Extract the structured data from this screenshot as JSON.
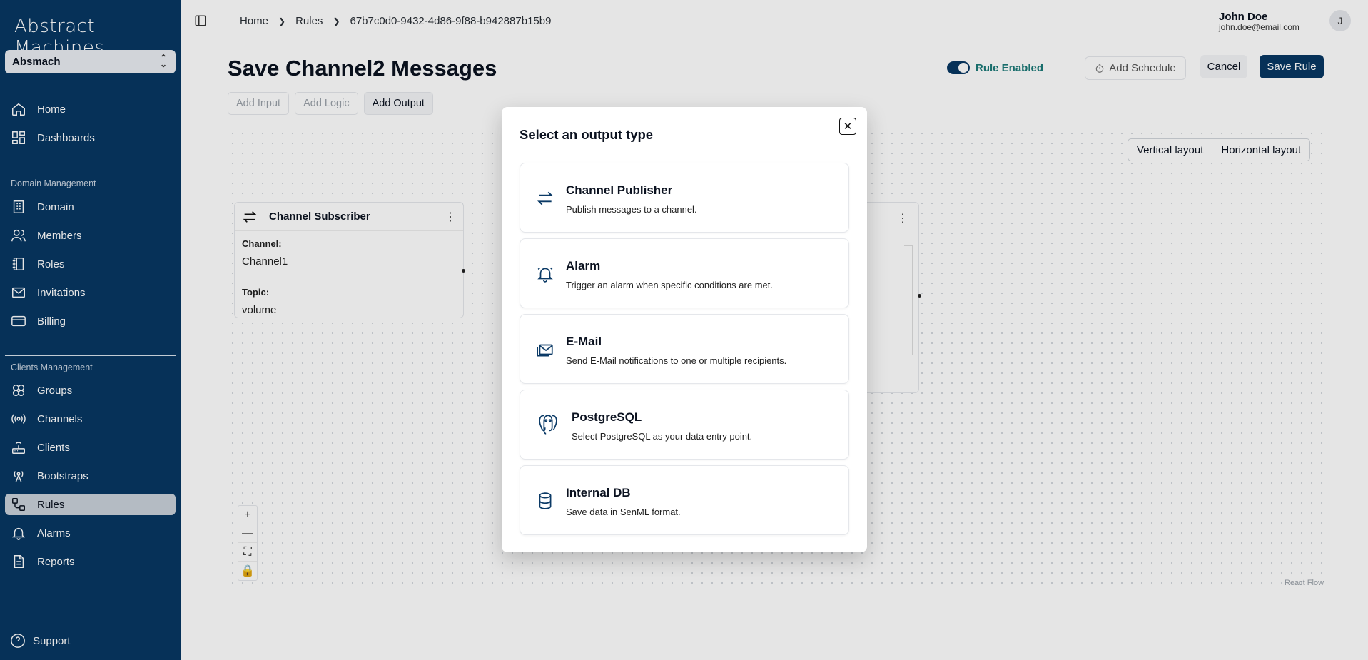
{
  "sidebar": {
    "brand": "Abstract Machines",
    "org": "Absmach",
    "nav_main": [
      {
        "label": "Home",
        "icon": "home-icon"
      },
      {
        "label": "Dashboards",
        "icon": "dashboard-icon"
      }
    ],
    "domain_section": "Domain Management",
    "nav_domain": [
      {
        "label": "Domain",
        "icon": "building-icon"
      },
      {
        "label": "Members",
        "icon": "members-icon"
      },
      {
        "label": "Roles",
        "icon": "book-icon"
      },
      {
        "label": "Invitations",
        "icon": "mail-icon"
      },
      {
        "label": "Billing",
        "icon": "credit-card-icon"
      }
    ],
    "clients_section": "Clients Management",
    "nav_clients": [
      {
        "label": "Groups",
        "icon": "groups-icon"
      },
      {
        "label": "Channels",
        "icon": "radio-icon"
      },
      {
        "label": "Clients",
        "icon": "router-icon"
      },
      {
        "label": "Bootstraps",
        "icon": "antenna-icon"
      },
      {
        "label": "Rules",
        "icon": "workflow-icon"
      },
      {
        "label": "Alarms",
        "icon": "bell-icon"
      },
      {
        "label": "Reports",
        "icon": "file-icon"
      }
    ],
    "support": "Support"
  },
  "header": {
    "breadcrumb": [
      "Home",
      "Rules",
      "67b7c0d0-9432-4d86-9f88-b942887b15b9"
    ],
    "user_name": "John Doe",
    "user_email": "john.doe@email.com",
    "avatar_initial": "J"
  },
  "page": {
    "title": "Save Channel2 Messages",
    "rule_enabled_label": "Rule Enabled",
    "add_schedule": "Add Schedule",
    "cancel": "Cancel",
    "save_rule": "Save Rule",
    "tabs": [
      "Add Input",
      "Add Logic",
      "Add Output"
    ],
    "vertical_layout": "Vertical layout",
    "horizontal_layout": "Horizontal layout",
    "react_flow": "React Flow"
  },
  "node": {
    "title": "Channel Subscriber",
    "channel_label": "Channel:",
    "channel_value": "Channel1",
    "topic_label": "Topic:",
    "topic_value": "volume"
  },
  "modal": {
    "title": "Select an output type",
    "options": [
      {
        "title": "Channel Publisher",
        "desc": "Publish messages to a channel.",
        "icon": "arrows-exchange-icon"
      },
      {
        "title": "Alarm",
        "desc": "Trigger an alarm when specific conditions are met.",
        "icon": "bell-ring-icon"
      },
      {
        "title": "E-Mail",
        "desc": "Send E-Mail notifications to one or multiple recipients.",
        "icon": "mail-stack-icon"
      },
      {
        "title": "PostgreSQL",
        "desc": "Select PostgreSQL as your data entry point.",
        "icon": "postgresql-icon"
      },
      {
        "title": "Internal DB",
        "desc": "Save data in SenML format.",
        "icon": "database-icon"
      }
    ]
  },
  "colors": {
    "sidebar_bg": "#073763",
    "accent": "#073763",
    "rule_enabled_text": "#1b7a78"
  }
}
